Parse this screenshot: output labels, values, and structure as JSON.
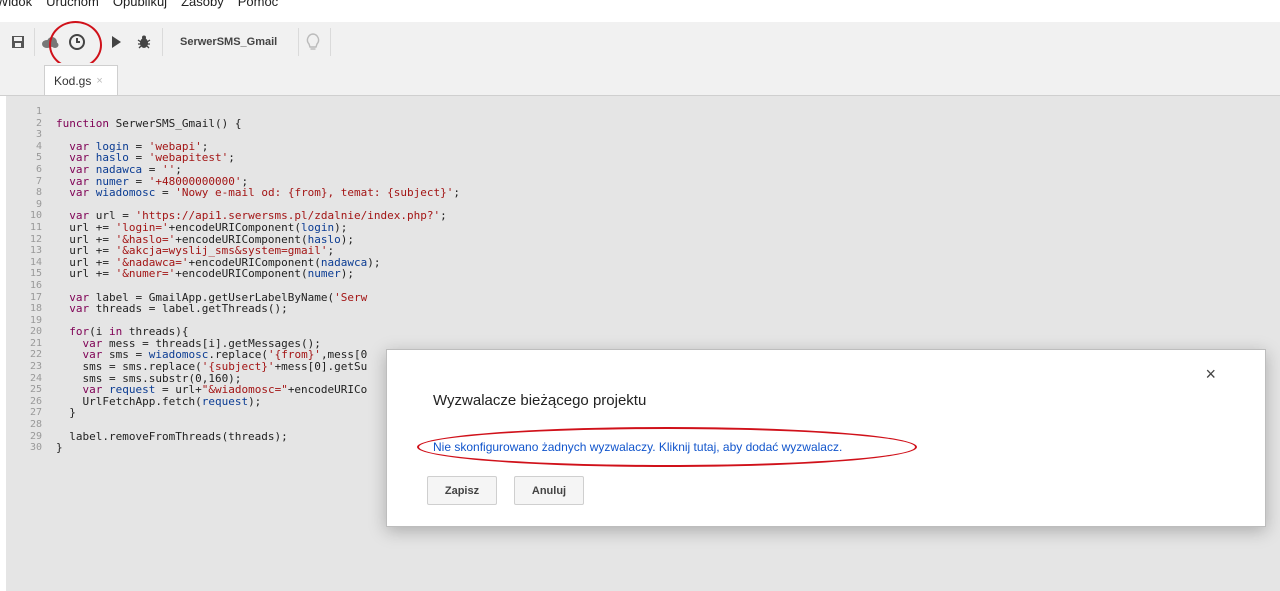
{
  "menu": [
    "Widok",
    "Uruchom",
    "Opublikuj",
    "Zasoby",
    "Pomoc"
  ],
  "toolbar": {
    "function_select": "SerwerSMS_Gmail",
    "icons": [
      "save-icon",
      "cloud-icon",
      "clock-triggers-icon",
      "play-icon",
      "bug-icon",
      "lightbulb-icon"
    ]
  },
  "tabs": [
    {
      "label": "Kod.gs",
      "close": "×"
    }
  ],
  "editor": {
    "line_numbers": [
      "1",
      "2",
      "3",
      "4",
      "5",
      "6",
      "7",
      "8",
      "9",
      "10",
      "11",
      "12",
      "13",
      "14",
      "15",
      "16",
      "17",
      "18",
      "19",
      "20",
      "21",
      "22",
      "23",
      "24",
      "25",
      "26",
      "27",
      "28",
      "29",
      "30"
    ],
    "lines": [
      "",
      "function SerwerSMS_Gmail() {",
      "",
      "  var login = 'webapi';",
      "  var haslo = 'webapitest';",
      "  var nadawca = '';",
      "  var numer = '+48000000000';",
      "  var wiadomosc = 'Nowy e-mail od: {from}, temat: {subject}';",
      "",
      "  var url = 'https://api1.serwersms.pl/zdalnie/index.php?';",
      "  url += 'login='+encodeURIComponent(login);",
      "  url += '&haslo='+encodeURIComponent(haslo);",
      "  url += '&akcja=wyslij_sms&system=gmail';",
      "  url += '&nadawca='+encodeURIComponent(nadawca);",
      "  url += '&numer='+encodeURIComponent(numer);",
      "",
      "  var label = GmailApp.getUserLabelByName('Serw",
      "  var threads = label.getThreads();",
      "",
      "  for(i in threads){",
      "    var mess = threads[i].getMessages();",
      "    var sms = wiadomosc.replace('{from}',mess[0",
      "    sms = sms.replace('{subject}'+mess[0].getSu",
      "    sms = sms.substr(0,160);",
      "    var request = url+\"&wiadomosc=\"+encodeURICo",
      "    UrlFetchApp.fetch(request);",
      "  }",
      "",
      "  label.removeFromThreads(threads);",
      "}"
    ]
  },
  "dialog": {
    "title": "Wyzwalacze bieżącego projektu",
    "link": "Nie skonfigurowano żadnych wyzwalaczy. Kliknij tutaj, aby dodać wyzwalacz.",
    "save_label": "Zapisz",
    "cancel_label": "Anuluj",
    "close": "×"
  },
  "colors": {
    "annotation_red": "#d0111a",
    "link_blue": "#1155cc"
  }
}
